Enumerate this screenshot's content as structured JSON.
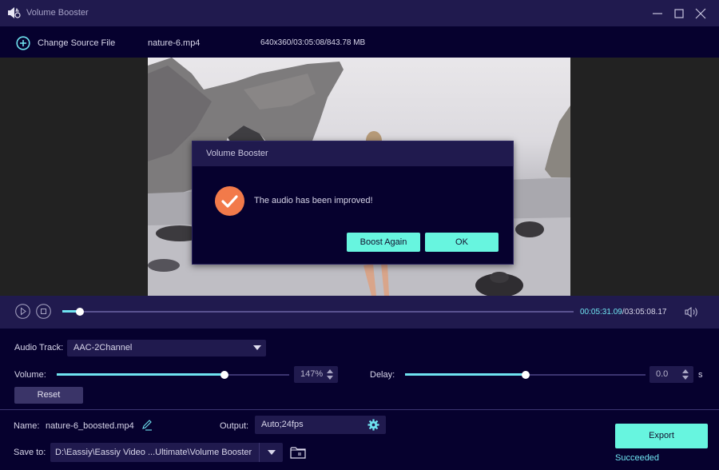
{
  "window": {
    "title": "Volume Booster",
    "controls": [
      "minimize",
      "maximize",
      "close"
    ]
  },
  "toolbar": {
    "change_source_label": "Change Source File",
    "file_name": "nature-6.mp4",
    "file_info": "640x360/03:05:08/843.78 MB"
  },
  "dialog": {
    "title": "Volume Booster",
    "icon": "check-circle-icon",
    "message": "The audio has been improved!",
    "boost_again_label": "Boost Again",
    "ok_label": "OK"
  },
  "player": {
    "current_time": "00:05:31.09",
    "separator": "/",
    "total_time": "03:05:08.17",
    "progress_fraction": 0.035
  },
  "settings": {
    "audio_track_label": "Audio Track:",
    "audio_track_value": "AAC-2Channel",
    "volume_label": "Volume:",
    "volume_value": "147%",
    "volume_fraction": 0.72,
    "delay_label": "Delay:",
    "delay_value": "0.0",
    "delay_unit": "s",
    "delay_fraction": 0.5,
    "reset_label": "Reset"
  },
  "output": {
    "name_label": "Name:",
    "name_value": "nature-6_boosted.mp4",
    "output_label": "Output:",
    "output_value": "Auto;24fps",
    "save_label": "Save to:",
    "save_path": "D:\\Eassiy\\Eassiy Video ...Ultimate\\Volume Booster",
    "export_label": "Export",
    "status": "Succeeded"
  },
  "colors": {
    "accent": "#67f5df",
    "accent_text": "#6fe3f0",
    "titlebar": "#201a4e",
    "background": "#06012e",
    "success_icon": "#f27a4a"
  }
}
